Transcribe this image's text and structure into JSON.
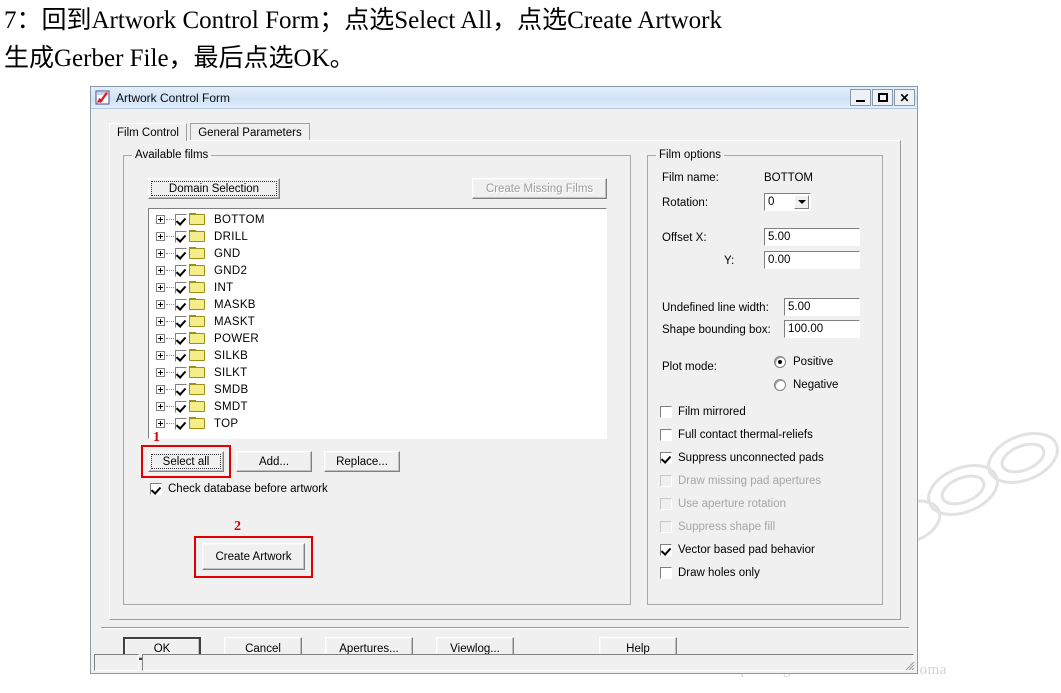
{
  "instructions": {
    "line1": "7：回到Artwork Control Form；点选Select All，点选Create Artwork",
    "line2": "生成Gerber File，最后点选OK。"
  },
  "watermark": "http://blog.csdn.net/hanxuexiaoma",
  "dialog": {
    "title": "Artwork Control Form",
    "icon": "artwork-app-icon",
    "window_buttons": {
      "minimize": "_",
      "maximize": "□",
      "close": "✕"
    },
    "tabs": [
      {
        "label": "Film Control",
        "active": true
      },
      {
        "label": "General Parameters",
        "active": false
      }
    ],
    "available_films": {
      "group_title": "Available films",
      "domain_selection_button": "Domain Selection",
      "create_missing_films_button": "Create Missing Films",
      "create_missing_films_disabled": true,
      "films": [
        {
          "name": "BOTTOM",
          "checked": true
        },
        {
          "name": "DRILL",
          "checked": true
        },
        {
          "name": "GND",
          "checked": true
        },
        {
          "name": "GND2",
          "checked": true
        },
        {
          "name": "INT",
          "checked": true
        },
        {
          "name": "MASKB",
          "checked": true
        },
        {
          "name": "MASKT",
          "checked": true
        },
        {
          "name": "POWER",
          "checked": true
        },
        {
          "name": "SILKB",
          "checked": true
        },
        {
          "name": "SILKT",
          "checked": true
        },
        {
          "name": "SMDB",
          "checked": true
        },
        {
          "name": "SMDT",
          "checked": true
        },
        {
          "name": "TOP",
          "checked": true
        }
      ],
      "select_all_button": "Select all",
      "add_button": "Add...",
      "replace_button": "Replace...",
      "check_database_checkbox": {
        "label": "Check database before artwork",
        "checked": true
      },
      "create_artwork_button": "Create Artwork"
    },
    "film_options": {
      "group_title": "Film options",
      "film_name_label": "Film name:",
      "film_name_value": "BOTTOM",
      "rotation_label": "Rotation:",
      "rotation_value": "0",
      "offset_x_label": "Offset  X:",
      "offset_x_value": "5.00",
      "offset_y_label": "Y:",
      "offset_y_value": "0.00",
      "undefined_line_width_label": "Undefined line width:",
      "undefined_line_width_value": "5.00",
      "shape_bounding_box_label": "Shape bounding box:",
      "shape_bounding_box_value": "100.00",
      "plot_mode_label": "Plot mode:",
      "plot_mode_options": [
        {
          "label": "Positive",
          "selected": true
        },
        {
          "label": "Negative",
          "selected": false
        }
      ],
      "checkboxes": [
        {
          "label": "Film mirrored",
          "checked": false,
          "disabled": false
        },
        {
          "label": "Full contact thermal-reliefs",
          "checked": false,
          "disabled": false
        },
        {
          "label": "Suppress unconnected pads",
          "checked": true,
          "disabled": false
        },
        {
          "label": "Draw missing pad apertures",
          "checked": false,
          "disabled": true
        },
        {
          "label": "Use aperture rotation",
          "checked": false,
          "disabled": true
        },
        {
          "label": "Suppress shape fill",
          "checked": false,
          "disabled": true
        },
        {
          "label": "Vector based pad behavior",
          "checked": true,
          "disabled": false
        },
        {
          "label": "Draw holes only",
          "checked": false,
          "disabled": false
        }
      ]
    },
    "bottom_buttons": [
      {
        "label": "OK",
        "default": true
      },
      {
        "label": "Cancel",
        "default": false
      },
      {
        "label": "Apertures...",
        "default": false
      },
      {
        "label": "Viewlog...",
        "default": false
      },
      {
        "label": "Help",
        "default": false
      }
    ]
  },
  "annotations": [
    {
      "number": "1",
      "target": "select-all-button"
    },
    {
      "number": "2",
      "target": "create-artwork-button"
    }
  ],
  "colors": {
    "annotation_red": "#e00000",
    "folder_yellow": "#f5ec8a",
    "titlebar_blue": "#d5e6f8",
    "dialog_face": "#f0f0f0"
  }
}
